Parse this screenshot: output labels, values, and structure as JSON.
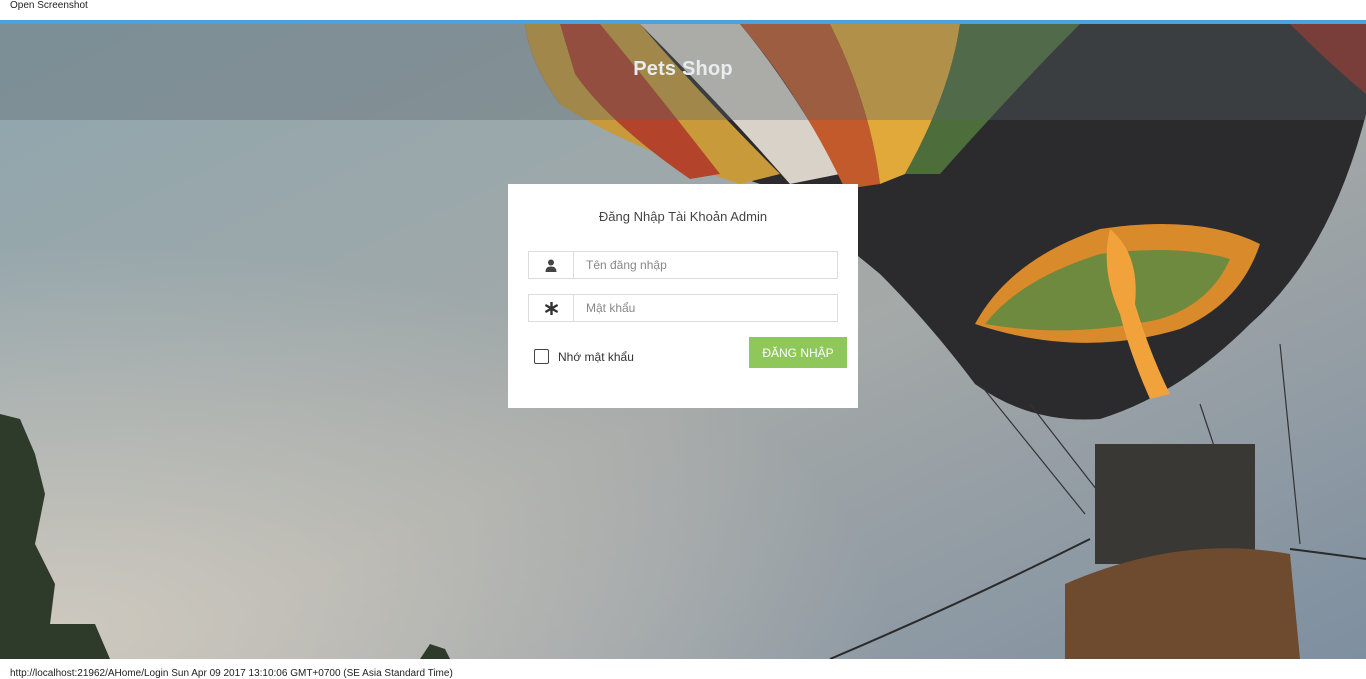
{
  "window": {
    "title": "Open Screenshot"
  },
  "header": {
    "brand": "Pets Shop"
  },
  "login": {
    "title": "Đăng Nhập Tài Khoản Admin",
    "username": {
      "placeholder": "Tên đăng nhập",
      "value": "",
      "icon": "user-icon"
    },
    "password": {
      "placeholder": "Mật khẩu",
      "value": "",
      "icon": "asterisk-icon"
    },
    "remember_label": "Nhớ mật khẩu",
    "remember_checked": false,
    "submit_label": "ĐĂNG NHẬP"
  },
  "status": {
    "text": "http://localhost:21962/AHome/Login Sun Apr 09 2017 13:10:06 GMT+0700 (SE Asia Standard Time)"
  },
  "colors": {
    "accent": "#4aa3df",
    "button": "#8fc75a"
  }
}
